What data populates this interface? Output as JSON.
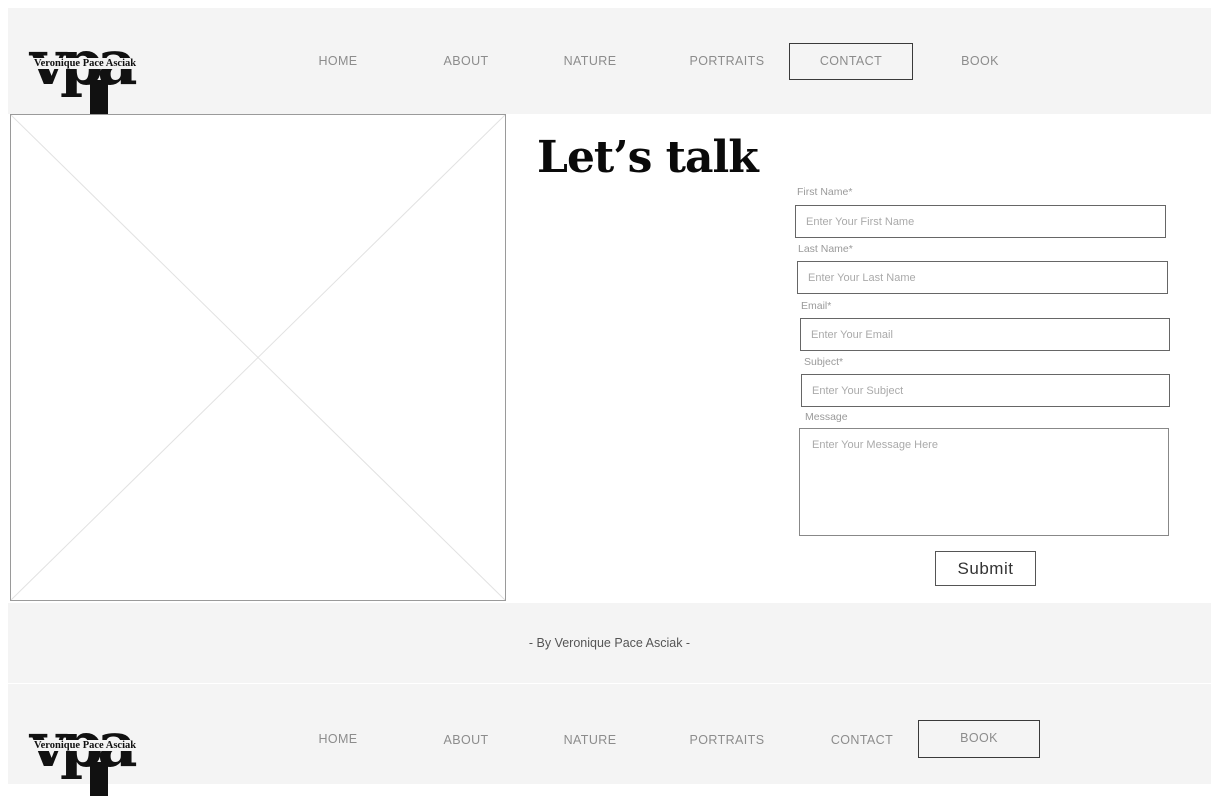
{
  "brand": {
    "mark": "vpa",
    "name": "Veronique Pace Asciak"
  },
  "header_nav": {
    "items": [
      "HOME",
      "ABOUT",
      "NATURE",
      "PORTRAITS",
      "CONTACT",
      "BOOK"
    ],
    "active": "CONTACT"
  },
  "page": {
    "title": "Let’s talk"
  },
  "form": {
    "first_name": {
      "label": "First Name*",
      "placeholder": "Enter Your First Name"
    },
    "last_name": {
      "label": "Last Name*",
      "placeholder": "Enter Your Last Name"
    },
    "email": {
      "label": "Email*",
      "placeholder": "Enter Your Email"
    },
    "subject": {
      "label": "Subject*",
      "placeholder": "Enter Your Subject"
    },
    "message": {
      "label": "Message",
      "placeholder": "Enter Your Message Here"
    },
    "submit_label": "Submit"
  },
  "footer": {
    "credit": "-  By Veronique Pace Asciak -"
  },
  "footer_nav": {
    "items": [
      "HOME",
      "ABOUT",
      "NATURE",
      "PORTRAITS",
      "CONTACT",
      "BOOK"
    ],
    "active": "BOOK"
  }
}
